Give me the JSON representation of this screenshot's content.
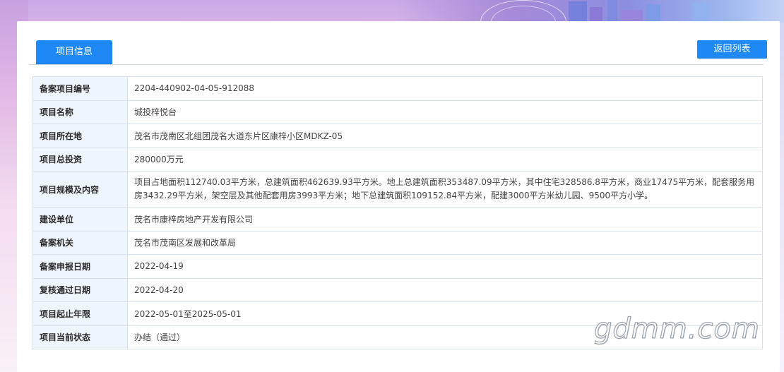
{
  "tabs": {
    "active_label": "项目信息"
  },
  "actions": {
    "back_label": "返回列表"
  },
  "project": {
    "rows": [
      {
        "label": "备案项目编号",
        "value": "2204-440902-04-05-912088"
      },
      {
        "label": "项目名称",
        "value": "城投梓悦台"
      },
      {
        "label": "项目所在地",
        "value": "茂名市茂南区北组团茂名大道东片区康梓小区MDKZ-05"
      },
      {
        "label": "项目总投资",
        "value": "280000万元"
      },
      {
        "label": "项目规模及内容",
        "value": "项目占地面积112740.03平方米，总建筑面积462639.93平方米。地上总建筑面积353487.09平方米，其中住宅328586.8平方米，商业17475平方米，配套服务用房3432.29平方米，架空层及其他配套用房3993平方米；地下总建筑面积109152.84平方米，配建3000平方米幼儿园、9500平方小学。"
      },
      {
        "label": "建设单位",
        "value": "茂名市康梓房地产开发有限公司"
      },
      {
        "label": "备案机关",
        "value": "茂名市茂南区发展和改革局"
      },
      {
        "label": "备案申报日期",
        "value": "2022-04-19"
      },
      {
        "label": "复核通过日期",
        "value": "2022-04-20"
      },
      {
        "label": "项目起止年限",
        "value": "2022-05-01至2025-05-01"
      },
      {
        "label": "项目当前状态",
        "value": "办结（通过）"
      }
    ]
  },
  "watermark": {
    "text": "gdmm.com"
  }
}
